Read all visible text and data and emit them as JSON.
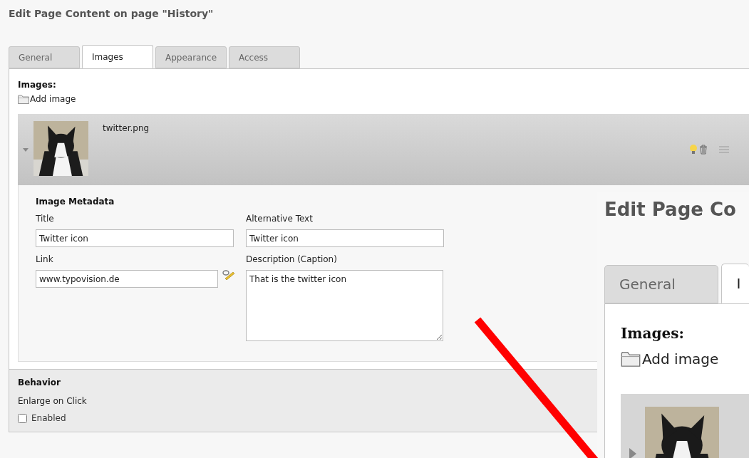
{
  "title": "Edit Page Content on page \"History\"",
  "tabs": [
    {
      "label": "General",
      "selected": false
    },
    {
      "label": "Images",
      "selected": true
    },
    {
      "label": "Appearance",
      "selected": false
    },
    {
      "label": "Access",
      "selected": false
    }
  ],
  "images": {
    "heading": "Images:",
    "add_label": "Add image",
    "items": [
      {
        "filename": "twitter.png",
        "expanded": true,
        "kind": "picture"
      }
    ]
  },
  "metadata": {
    "heading": "Image Metadata",
    "fields": [
      {
        "kind": "text",
        "label": "Title",
        "value": "Twitter icon"
      },
      {
        "kind": "text",
        "label": "Alternative Text",
        "value": "Twitter icon"
      },
      {
        "kind": "link",
        "label": "Link",
        "value": "www.typovision.de"
      },
      {
        "kind": "textarea",
        "label": "Description (Caption)",
        "value": "That is the twitter icon"
      }
    ]
  },
  "behavior": {
    "heading": "Behavior",
    "field_label": "Enlarge on Click",
    "checkbox": {
      "label": "Enabled",
      "checked": false
    }
  },
  "inset": {
    "title": "Edit Page Co",
    "tabs": [
      {
        "label": "General",
        "selected": false
      },
      {
        "label": "I",
        "selected": true
      }
    ],
    "heading": "Images:",
    "add_label": "Add image"
  }
}
